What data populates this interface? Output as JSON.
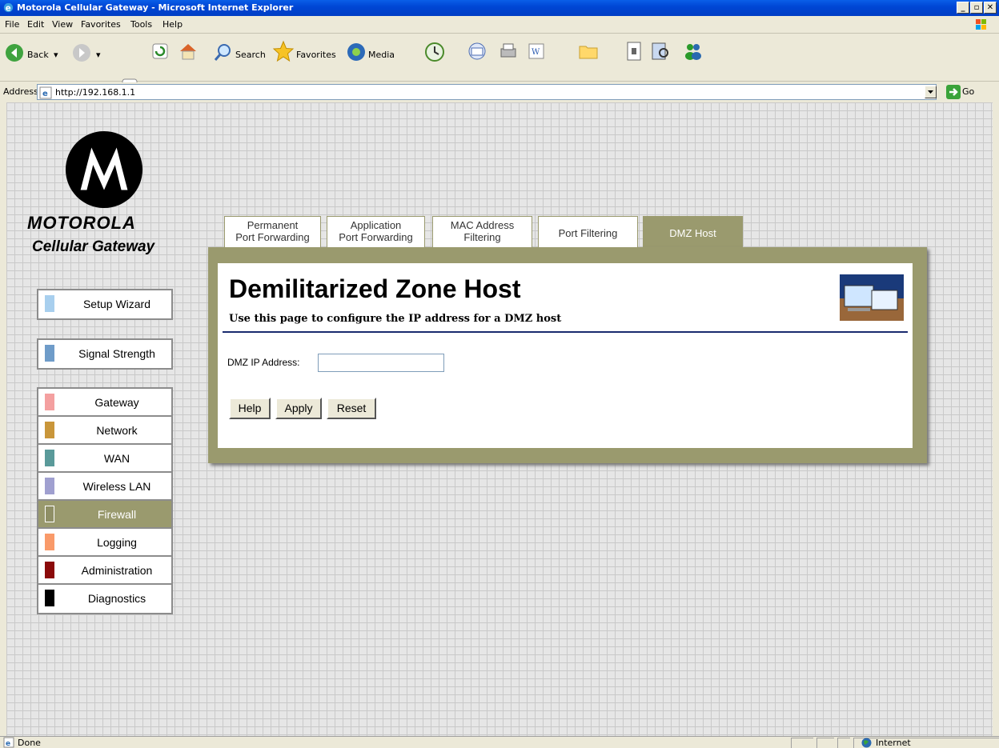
{
  "window": {
    "title": "Motorola Cellular Gateway - Microsoft Internet Explorer",
    "min_glyph": "_",
    "max_glyph": "▫",
    "close_glyph": "✕"
  },
  "menu": [
    "File",
    "Edit",
    "View",
    "Favorites",
    "Tools",
    "Help"
  ],
  "toolbar": {
    "back": "Back",
    "search": "Search",
    "favorites": "Favorites",
    "media": "Media"
  },
  "address": {
    "label": "Address",
    "url": "http://192.168.1.1",
    "go": "Go"
  },
  "brand": {
    "name": "MOTOROLA",
    "subtitle": "Cellular Gateway"
  },
  "nav": {
    "group1": [
      {
        "label": "Setup Wizard",
        "color": "#a8cfee"
      }
    ],
    "group2": [
      {
        "label": "Signal Strength",
        "color": "#6f9cc9"
      }
    ],
    "group3": [
      {
        "label": "Gateway",
        "color": "#f4a0a0"
      },
      {
        "label": "Network",
        "color": "#c9963a"
      },
      {
        "label": "WAN",
        "color": "#5a9a9a"
      },
      {
        "label": "Wireless LAN",
        "color": "#a0a0d0"
      },
      {
        "label": "Firewall",
        "color": "#8f8f66",
        "active": true
      },
      {
        "label": "Logging",
        "color": "#f99a6a"
      },
      {
        "label": "Administration",
        "color": "#8b0a0a"
      },
      {
        "label": "Diagnostics",
        "color": "#000000"
      }
    ]
  },
  "tabs": [
    {
      "line1": "Permanent",
      "line2": "Port Forwarding"
    },
    {
      "line1": "Application",
      "line2": "Port Forwarding"
    },
    {
      "line1": "MAC Address",
      "line2": "Filtering"
    },
    {
      "line1": "Port Filtering",
      "line2": ""
    },
    {
      "line1": "DMZ Host",
      "line2": "",
      "active": true
    }
  ],
  "page": {
    "title": "Demilitarized Zone Host",
    "subtitle": "Use this page to configure the IP address for a DMZ host",
    "field_label": "DMZ IP Address:",
    "field_value": "",
    "buttons": {
      "help": "Help",
      "apply": "Apply",
      "reset": "Reset"
    }
  },
  "status": {
    "text": "Done",
    "zone": "Internet"
  },
  "colors": {
    "accent": "#9a9a6e",
    "rule": "#1a2a6e",
    "titlebar": "#0046d5"
  }
}
